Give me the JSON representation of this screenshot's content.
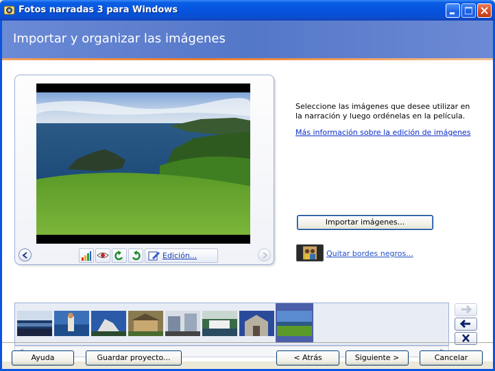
{
  "window": {
    "title": "Fotos narradas 3 para Windows"
  },
  "header": {
    "title": "Importar y organizar las imágenes"
  },
  "instructions": {
    "text": "Seleccione las imágenes que desee utilizar en la narración y luego ordénelas en la película.",
    "more_info_link": "Más información sobre la edición de imágenes"
  },
  "preview": {
    "edit_label": "Edición...",
    "tools": [
      "auto-levels-icon",
      "red-eye-icon",
      "rotate-left-icon",
      "rotate-right-icon"
    ]
  },
  "actions": {
    "import_label": "Importar imágenes...",
    "remove_borders_label": "Quitar bordes negros..."
  },
  "filmstrip": {
    "thumbnail_count": 8,
    "selected_index": 7
  },
  "footer": {
    "help": "Ayuda",
    "save_project": "Guardar proyecto...",
    "back": "< Atrás",
    "next": "Siguiente >",
    "cancel": "Cancelar"
  },
  "colors": {
    "titlebar": "#0553df",
    "header": "#5477c8",
    "accent_stripe": "#e87a28",
    "link": "#0a2cc8",
    "selection": "#4a5fa8"
  }
}
